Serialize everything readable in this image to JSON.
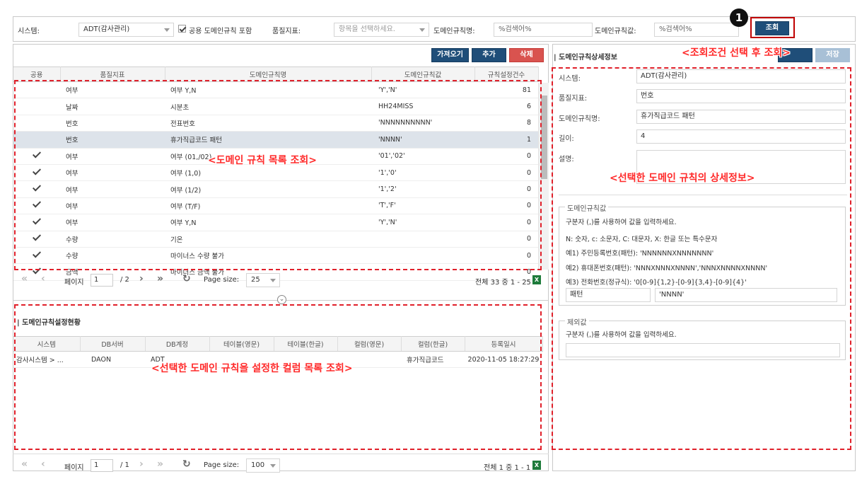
{
  "search": {
    "system_label": "시스템:",
    "system_value": "ADT(감사관리)",
    "common_checkbox_label": "공용 도메인규칙 포함",
    "quality_label": "품질지표:",
    "quality_placeholder": "항목을 선택하세요.",
    "rule_name_label": "도메인규칙명:",
    "rule_name_value": "%검색어%",
    "rule_value_label": "도메인규칙값:",
    "rule_value_value": "%검색어%",
    "search_button": "조회"
  },
  "toolbar": {
    "import": "가져오기",
    "add": "추가",
    "delete": "삭제"
  },
  "rule_grid": {
    "columns": [
      "공용",
      "품질지표",
      "도메인규칙명",
      "도메인규칙값",
      "규칙설정건수"
    ],
    "rows": [
      {
        "common": false,
        "quality": "여부",
        "name": "여부 Y,N",
        "value": "'Y','N'",
        "count": "81"
      },
      {
        "common": false,
        "quality": "날짜",
        "name": "시분초",
        "value": "HH24MISS",
        "count": "6"
      },
      {
        "common": false,
        "quality": "번호",
        "name": "전표번호",
        "value": "'NNNNNNNNNN'",
        "count": "8"
      },
      {
        "common": false,
        "quality": "번호",
        "name": "휴가직급코드 패턴",
        "value": "'NNNN'",
        "count": "1",
        "selected": true
      },
      {
        "common": true,
        "quality": "여부",
        "name": "여부 (01,/02)",
        "value": "'01','02'",
        "count": "0"
      },
      {
        "common": true,
        "quality": "여부",
        "name": "여부 (1,0)",
        "value": "'1','0'",
        "count": "0"
      },
      {
        "common": true,
        "quality": "여부",
        "name": "여부 (1/2)",
        "value": "'1','2'",
        "count": "0"
      },
      {
        "common": true,
        "quality": "여부",
        "name": "여부 (T/F)",
        "value": "'T','F'",
        "count": "0"
      },
      {
        "common": true,
        "quality": "여부",
        "name": "여부 Y,N",
        "value": "'Y','N'",
        "count": "0"
      },
      {
        "common": true,
        "quality": "수량",
        "name": "기온",
        "value": "",
        "count": "0"
      },
      {
        "common": true,
        "quality": "수량",
        "name": "마이너스 수량 불가",
        "value": "",
        "count": "0"
      },
      {
        "common": true,
        "quality": "금액",
        "name": "마이너스 금액 불가",
        "value": "",
        "count": "0"
      }
    ]
  },
  "pager1": {
    "page_label": "페이지",
    "page": "1",
    "total_pages": "/ 2",
    "page_size_label": "Page size:",
    "page_size": "25",
    "summary": "전체 33 중 1 - 25"
  },
  "column_section": {
    "title": "도메인규칙설정현황",
    "columns": [
      "시스템",
      "DB서버",
      "DB계정",
      "테이블(영문)",
      "테이블(한글)",
      "컬럼(영문)",
      "컬럼(한글)",
      "등록일시"
    ],
    "rows": [
      {
        "system": "감사시스템 > ...",
        "server": "DAON",
        "account": "ADT",
        "table_en": "",
        "table_ko": "",
        "col_en": "",
        "col_ko": "휴가직급코드",
        "date": "2020-11-05 18:27:29"
      }
    ]
  },
  "pager2": {
    "page_label": "페이지",
    "page": "1",
    "total_pages": "/ 1",
    "page_size_label": "Page size:",
    "page_size": "100",
    "summary": "전체 1 중 1 - 1"
  },
  "detail": {
    "title": "도메인규칙상세정보",
    "save_button": "저장",
    "system_label": "시스템:",
    "system_value": "ADT(감사관리)",
    "quality_label": "품질지표:",
    "quality_value": "번호",
    "name_label": "도메인규칙명:",
    "name_value": "휴가직급코드 패턴",
    "length_label": "길이:",
    "length_value": "4",
    "desc_label": "설명:",
    "desc_value": "",
    "rule_legend": "도메인규칙값",
    "rule_help1": "구분자 (,)를 사용하여 값을 입력하세요.",
    "rule_help2": "N: 숫자, c: 소문자, C: 대문자, X: 한글 또는 특수문자",
    "rule_ex1": "예1) 주민등록번호(패턴): 'NNNNNNXNNNNNNN'",
    "rule_ex2": "예2) 휴대폰번호(패턴): 'NNNXNNNXNNNN','NNNXNNNNXNNNN'",
    "rule_ex3": "예3) 전화번호(정규식): '0[0-9]{1,2}-[0-9]{3,4}-[0-9]{4}'",
    "rule_type": "패턴",
    "rule_value": "'NNNN'",
    "except_legend": "제외값",
    "except_help": "구분자 (,)를 사용하여 값을 입력하세요.",
    "except_value": ""
  },
  "annotations": {
    "badge": "1",
    "search": "<조회조건 선택 후 조회>",
    "rule_list": "<도메인 규칙 목록 조회>",
    "detail": "<선택한 도메인 규칙의 상세정보>",
    "columns": "<선택한 도메인 규칙을 설정한 컬럼 목록 조회>"
  },
  "colors": {
    "navy": "#1f4e79",
    "red": "#d9534f",
    "annotation": "#ff2a2a"
  }
}
